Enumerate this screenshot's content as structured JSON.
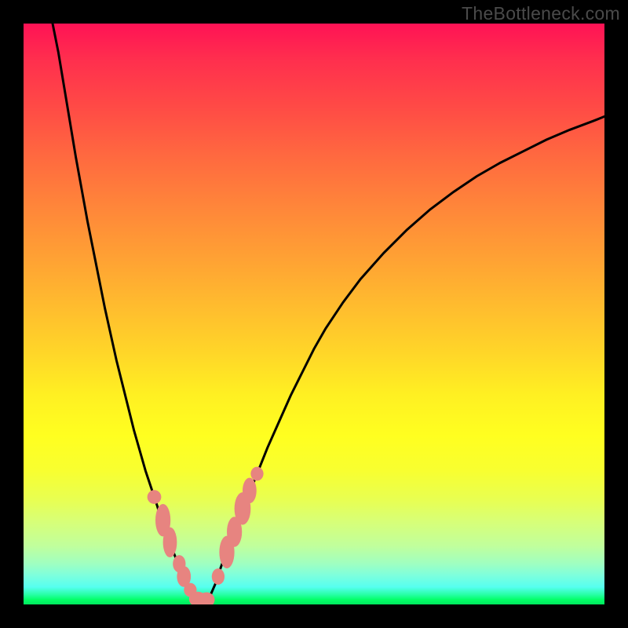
{
  "watermark": "TheBottleneck.com",
  "colors": {
    "curve_stroke": "#000000",
    "marker_fill": "#e78480",
    "background_black": "#000000"
  },
  "chart_data": {
    "type": "line",
    "title": "",
    "xlabel": "",
    "ylabel": "",
    "xlim": [
      0,
      100
    ],
    "ylim": [
      0,
      100
    ],
    "x": [
      5,
      6,
      7,
      8,
      9,
      10,
      11,
      12,
      13,
      14,
      15,
      16,
      17,
      18,
      19,
      20,
      21,
      22,
      23,
      24,
      25,
      26,
      27,
      28,
      29,
      30,
      31,
      32,
      33,
      34,
      36,
      38,
      40,
      42,
      44,
      46,
      48,
      50,
      52,
      55,
      58,
      62,
      66,
      70,
      74,
      78,
      82,
      86,
      90,
      94,
      98,
      100
    ],
    "values": [
      100.0,
      95.0,
      89.0,
      83.0,
      77.0,
      71.5,
      66.0,
      61.0,
      56.0,
      51.0,
      46.5,
      42.0,
      38.0,
      34.0,
      30.0,
      26.5,
      23.0,
      20.0,
      17.0,
      13.7,
      11.0,
      8.5,
      6.0,
      3.8,
      2.0,
      0.9,
      0.6,
      1.2,
      3.5,
      6.5,
      12.0,
      17.0,
      22.0,
      27.0,
      31.5,
      36.0,
      40.0,
      44.0,
      47.5,
      52.0,
      56.0,
      60.5,
      64.5,
      68.0,
      71.0,
      73.7,
      76.0,
      78.0,
      80.0,
      81.7,
      83.2,
      84.0
    ],
    "markers": [
      {
        "x": 22.5,
        "y": 18.5,
        "rx": 1.2,
        "ry": 1.2
      },
      {
        "x": 24.0,
        "y": 14.5,
        "rx": 1.3,
        "ry": 2.8
      },
      {
        "x": 25.2,
        "y": 10.7,
        "rx": 1.2,
        "ry": 2.6
      },
      {
        "x": 26.8,
        "y": 7.0,
        "rx": 1.1,
        "ry": 1.5
      },
      {
        "x": 27.6,
        "y": 4.8,
        "rx": 1.2,
        "ry": 1.8
      },
      {
        "x": 28.7,
        "y": 2.5,
        "rx": 1.1,
        "ry": 1.2
      },
      {
        "x": 30.0,
        "y": 0.9,
        "rx": 1.5,
        "ry": 1.3
      },
      {
        "x": 31.5,
        "y": 0.8,
        "rx": 1.4,
        "ry": 1.3
      },
      {
        "x": 33.5,
        "y": 4.8,
        "rx": 1.1,
        "ry": 1.4
      },
      {
        "x": 35.0,
        "y": 9.0,
        "rx": 1.3,
        "ry": 2.8
      },
      {
        "x": 36.3,
        "y": 12.5,
        "rx": 1.3,
        "ry": 2.6
      },
      {
        "x": 37.7,
        "y": 16.5,
        "rx": 1.4,
        "ry": 2.8
      },
      {
        "x": 38.9,
        "y": 19.6,
        "rx": 1.2,
        "ry": 2.2
      },
      {
        "x": 40.2,
        "y": 22.5,
        "rx": 1.1,
        "ry": 1.2
      }
    ]
  }
}
